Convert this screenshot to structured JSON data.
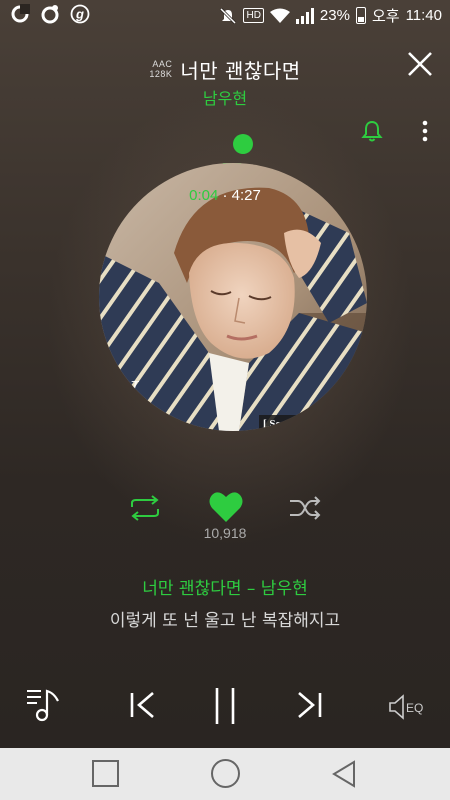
{
  "status": {
    "battery": "23%",
    "ampm": "오후",
    "time": "11:40",
    "hd_badge": "HD"
  },
  "header": {
    "codec_top": "AAC",
    "codec_bottom": "128K",
    "song_title": "너만 괜찮다면",
    "artist": "남우현"
  },
  "player": {
    "current_time": "0:04",
    "separator": "·",
    "total_time": "4:27",
    "progress_fraction": 0.015,
    "like_count": "10,918",
    "song_line": "너만 괜찮다면 – 남우현",
    "lyric_line": "이렇게 또 넌 울고 난 복잡해지고",
    "album_text": "[ Second"
  },
  "controls": {
    "eq_label": "EQ"
  },
  "colors": {
    "accent": "#2ecc40"
  }
}
